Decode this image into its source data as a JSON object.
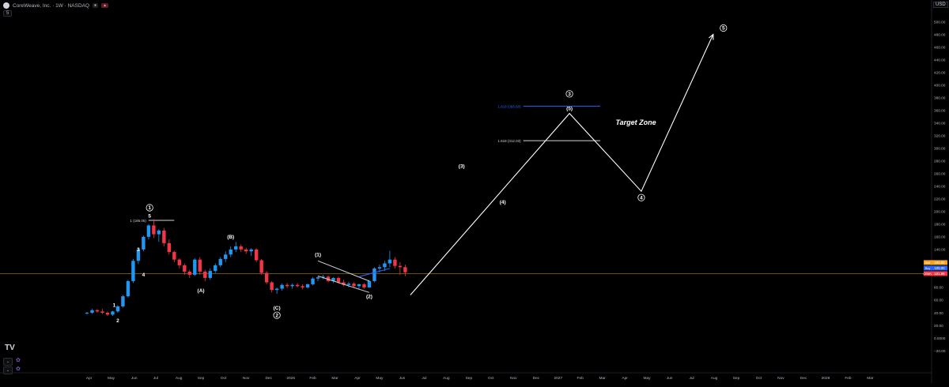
{
  "header": {
    "symbol_title": "CoreWeave, Inc. · 1W · NASDAQ",
    "interval_label": "5",
    "currency": "USD",
    "tv_logo": "TV"
  },
  "price_badges": {
    "blue": {
      "label": "Buy",
      "value": "105.00"
    },
    "orange": {
      "label": "Sell",
      "value": "105.00"
    },
    "red": {
      "label": "CRWV",
      "value": "101.89"
    }
  },
  "pane_controls": {
    "collapse_symbol": "⌄",
    "indicator_icon": "✿"
  },
  "chart_data": {
    "type": "candlestick",
    "title": "",
    "xlabel": "",
    "ylabel": "",
    "ylim": [
      -20,
      520
    ],
    "y_ticks": [
      -20,
      0,
      20,
      40,
      60,
      80,
      100,
      120,
      140,
      160,
      180,
      200,
      220,
      240,
      260,
      280,
      300,
      320,
      340,
      360,
      380,
      400,
      420,
      440,
      460,
      480,
      500
    ],
    "y_tick_labels": [
      "−20.00",
      "0.0000",
      "20.00",
      "40.00",
      "60.00",
      "80.00",
      "100.00",
      "120.00",
      "140.00",
      "160.00",
      "180.00",
      "200.00",
      "220.00",
      "240.00",
      "260.00",
      "280.00",
      "300.00",
      "320.00",
      "340.00",
      "360.00",
      "380.00",
      "400.00",
      "420.00",
      "440.00",
      "460.00",
      "480.00",
      "500.00"
    ],
    "x_ticks": [
      {
        "label": "Apr",
        "week": 0.4
      },
      {
        "label": "May",
        "week": 4.7
      },
      {
        "label": "Jun",
        "week": 9.2
      },
      {
        "label": "Jul",
        "week": 13.4
      },
      {
        "label": "Aug",
        "week": 17.9
      },
      {
        "label": "Sep",
        "week": 22.2
      },
      {
        "label": "Oct",
        "week": 26.6
      },
      {
        "label": "Nov",
        "week": 31.0
      },
      {
        "label": "Dec",
        "week": 35.4
      },
      {
        "label": "2026",
        "week": 39.7
      },
      {
        "label": "Feb",
        "week": 44.0
      },
      {
        "label": "Mar",
        "week": 48.3
      },
      {
        "label": "Apr",
        "week": 52.7
      },
      {
        "label": "May",
        "week": 57.0
      },
      {
        "label": "Jun",
        "week": 61.4
      },
      {
        "label": "Jul",
        "week": 65.7
      },
      {
        "label": "Aug",
        "week": 70.0
      },
      {
        "label": "Sep",
        "week": 74.4
      },
      {
        "label": "Oct",
        "week": 78.7
      },
      {
        "label": "Nov",
        "week": 83.1
      },
      {
        "label": "Dec",
        "week": 87.5
      },
      {
        "label": "2027",
        "week": 91.8
      },
      {
        "label": "Feb",
        "week": 96.1
      },
      {
        "label": "Mar",
        "week": 100.4
      },
      {
        "label": "Apr",
        "week": 104.8
      },
      {
        "label": "May",
        "week": 109.1
      },
      {
        "label": "Jun",
        "week": 113.5
      },
      {
        "label": "Jul",
        "week": 117.8
      },
      {
        "label": "Aug",
        "week": 122.2
      },
      {
        "label": "Sep",
        "week": 126.5
      },
      {
        "label": "Oct",
        "week": 130.9
      },
      {
        "label": "Nov",
        "week": 135.2
      },
      {
        "label": "Dec",
        "week": 139.6
      },
      {
        "label": "2028",
        "week": 143.9
      },
      {
        "label": "Feb",
        "week": 148.3
      },
      {
        "label": "Mar",
        "week": 152.6
      }
    ],
    "candles": [
      {
        "o": 40,
        "h": 41,
        "l": 37,
        "c": 40
      },
      {
        "o": 40,
        "h": 46,
        "l": 38,
        "c": 44
      },
      {
        "o": 44,
        "h": 46,
        "l": 40,
        "c": 42
      },
      {
        "o": 42,
        "h": 46,
        "l": 38,
        "c": 40
      },
      {
        "o": 40,
        "h": 42,
        "l": 35,
        "c": 37
      },
      {
        "o": 37,
        "h": 43,
        "l": 35,
        "c": 42
      },
      {
        "o": 42,
        "h": 52,
        "l": 40,
        "c": 50
      },
      {
        "o": 50,
        "h": 68,
        "l": 48,
        "c": 66
      },
      {
        "o": 66,
        "h": 92,
        "l": 64,
        "c": 90
      },
      {
        "o": 90,
        "h": 125,
        "l": 87,
        "c": 122
      },
      {
        "o": 122,
        "h": 142,
        "l": 117,
        "c": 140
      },
      {
        "o": 140,
        "h": 162,
        "l": 137,
        "c": 160
      },
      {
        "o": 160,
        "h": 180,
        "l": 156,
        "c": 178
      },
      {
        "o": 178,
        "h": 188,
        "l": 158,
        "c": 164
      },
      {
        "o": 164,
        "h": 172,
        "l": 152,
        "c": 170
      },
      {
        "o": 170,
        "h": 174,
        "l": 145,
        "c": 150
      },
      {
        "o": 150,
        "h": 156,
        "l": 132,
        "c": 136
      },
      {
        "o": 136,
        "h": 138,
        "l": 120,
        "c": 124
      },
      {
        "o": 124,
        "h": 126,
        "l": 110,
        "c": 115
      },
      {
        "o": 115,
        "h": 118,
        "l": 100,
        "c": 105
      },
      {
        "o": 105,
        "h": 108,
        "l": 95,
        "c": 100
      },
      {
        "o": 100,
        "h": 126,
        "l": 98,
        "c": 124
      },
      {
        "o": 124,
        "h": 128,
        "l": 100,
        "c": 105
      },
      {
        "o": 105,
        "h": 108,
        "l": 90,
        "c": 95
      },
      {
        "o": 95,
        "h": 110,
        "l": 92,
        "c": 106
      },
      {
        "o": 106,
        "h": 118,
        "l": 103,
        "c": 115
      },
      {
        "o": 115,
        "h": 128,
        "l": 112,
        "c": 125
      },
      {
        "o": 125,
        "h": 137,
        "l": 120,
        "c": 132
      },
      {
        "o": 132,
        "h": 145,
        "l": 128,
        "c": 140
      },
      {
        "o": 140,
        "h": 152,
        "l": 136,
        "c": 145
      },
      {
        "o": 145,
        "h": 148,
        "l": 136,
        "c": 140
      },
      {
        "o": 140,
        "h": 143,
        "l": 133,
        "c": 137
      },
      {
        "o": 137,
        "h": 142,
        "l": 130,
        "c": 140
      },
      {
        "o": 140,
        "h": 142,
        "l": 120,
        "c": 123
      },
      {
        "o": 123,
        "h": 125,
        "l": 100,
        "c": 103
      },
      {
        "o": 103,
        "h": 106,
        "l": 85,
        "c": 88
      },
      {
        "o": 88,
        "h": 90,
        "l": 72,
        "c": 76
      },
      {
        "o": 76,
        "h": 80,
        "l": 70,
        "c": 78
      },
      {
        "o": 78,
        "h": 86,
        "l": 75,
        "c": 84
      },
      {
        "o": 84,
        "h": 87,
        "l": 79,
        "c": 82
      },
      {
        "o": 82,
        "h": 86,
        "l": 78,
        "c": 84
      },
      {
        "o": 84,
        "h": 87,
        "l": 80,
        "c": 82
      },
      {
        "o": 82,
        "h": 85,
        "l": 77,
        "c": 80
      },
      {
        "o": 80,
        "h": 86,
        "l": 78,
        "c": 85
      },
      {
        "o": 85,
        "h": 96,
        "l": 83,
        "c": 94
      },
      {
        "o": 94,
        "h": 98,
        "l": 90,
        "c": 96
      },
      {
        "o": 96,
        "h": 100,
        "l": 93,
        "c": 97
      },
      {
        "o": 97,
        "h": 99,
        "l": 88,
        "c": 90
      },
      {
        "o": 90,
        "h": 96,
        "l": 87,
        "c": 95
      },
      {
        "o": 95,
        "h": 97,
        "l": 86,
        "c": 88
      },
      {
        "o": 88,
        "h": 92,
        "l": 82,
        "c": 84
      },
      {
        "o": 84,
        "h": 89,
        "l": 80,
        "c": 86
      },
      {
        "o": 86,
        "h": 88,
        "l": 80,
        "c": 82
      },
      {
        "o": 82,
        "h": 86,
        "l": 78,
        "c": 85
      },
      {
        "o": 85,
        "h": 87,
        "l": 78,
        "c": 80
      },
      {
        "o": 80,
        "h": 92,
        "l": 79,
        "c": 90
      },
      {
        "o": 90,
        "h": 112,
        "l": 88,
        "c": 110
      },
      {
        "o": 110,
        "h": 116,
        "l": 104,
        "c": 112
      },
      {
        "o": 112,
        "h": 122,
        "l": 106,
        "c": 118
      },
      {
        "o": 118,
        "h": 138,
        "l": 112,
        "c": 124
      },
      {
        "o": 124,
        "h": 128,
        "l": 110,
        "c": 114
      },
      {
        "o": 114,
        "h": 120,
        "l": 100,
        "c": 112
      },
      {
        "o": 112,
        "h": 116,
        "l": 98,
        "c": 104
      }
    ],
    "series": [
      {
        "name": "",
        "type": "projection_path",
        "points": [
          [
            63,
            68
          ],
          [
            94,
            355
          ],
          [
            108,
            232
          ],
          [
            122,
            480
          ]
        ]
      },
      {
        "name": "",
        "type": "trendline",
        "points": [
          [
            45,
            122
          ],
          [
            55,
            90
          ]
        ]
      },
      {
        "name": "",
        "type": "trendline",
        "points": [
          [
            45,
            98
          ],
          [
            55,
            72
          ]
        ]
      },
      {
        "name": "",
        "type": "trendline",
        "points": [
          [
            53,
            97
          ],
          [
            59,
            110
          ]
        ]
      }
    ],
    "horizontal_levels": [
      {
        "label": "1 (186.05)",
        "value": 186.05,
        "x_from": 12,
        "x_to": 17,
        "color": "#d1d4dc"
      },
      {
        "label": "1.618 (366.60)",
        "value": 366.6,
        "x_from": 85,
        "x_to": 100,
        "color": "#2962ff"
      },
      {
        "label": "1.618 (312.03)",
        "value": 312.03,
        "x_from": 85,
        "x_to": 100,
        "color": "#d1d4dc"
      }
    ],
    "current_price_line": 101.89,
    "wave_labels": [
      {
        "text": "1",
        "week": 12.2,
        "price": 206,
        "circled": true
      },
      {
        "text": "5",
        "week": 12.2,
        "price": 193,
        "circled": false
      },
      {
        "text": "1",
        "week": 5.3,
        "price": 52,
        "circled": false
      },
      {
        "text": "2",
        "week": 6.0,
        "price": 28,
        "circled": false
      },
      {
        "text": "3",
        "week": 10.0,
        "price": 140,
        "circled": false
      },
      {
        "text": "4",
        "week": 11.0,
        "price": 100,
        "circled": false
      },
      {
        "text": "(A)",
        "week": 22.2,
        "price": 75,
        "circled": false
      },
      {
        "text": "(B)",
        "week": 28.0,
        "price": 160,
        "circled": false
      },
      {
        "text": "(C)",
        "week": 37.0,
        "price": 48,
        "circled": false
      },
      {
        "text": "2",
        "week": 37.0,
        "price": 36,
        "circled": true
      },
      {
        "text": "(1)",
        "week": 45.0,
        "price": 132,
        "circled": false
      },
      {
        "text": "(2)",
        "week": 55.0,
        "price": 66,
        "circled": false
      },
      {
        "text": "(3)",
        "week": 73.0,
        "price": 272,
        "circled": false
      },
      {
        "text": "(4)",
        "week": 81.0,
        "price": 215,
        "circled": false
      },
      {
        "text": "(5)",
        "week": 94.0,
        "price": 363,
        "circled": false
      },
      {
        "text": "3",
        "week": 94.0,
        "price": 386,
        "circled": true
      },
      {
        "text": "4",
        "week": 108.0,
        "price": 222,
        "circled": true
      },
      {
        "text": "5",
        "week": 124.0,
        "price": 490,
        "circled": true
      }
    ],
    "annotations": [
      {
        "text": "Target Zone",
        "week": 103.0,
        "price": 337
      }
    ],
    "colors": {
      "up": "#2196f3",
      "down": "#f23645",
      "projection": "#ffffff",
      "background": "#000000",
      "price_line": "#8d6e1f"
    },
    "grid": false,
    "legend": "none"
  }
}
